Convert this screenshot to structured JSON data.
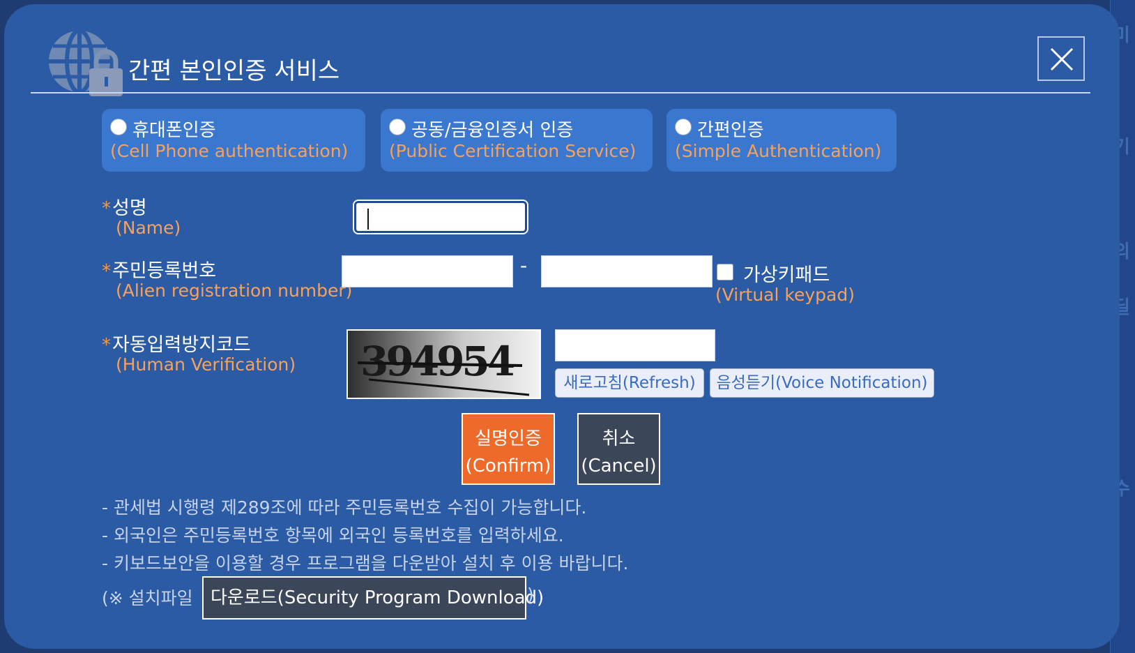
{
  "dialog": {
    "title": "간편 본인인증 서비스",
    "close_label": "X"
  },
  "auth_methods": [
    {
      "label_ko": "휴대폰인증",
      "label_en": "(Cell Phone authentication)",
      "selected": false
    },
    {
      "label_ko": "공동/금융인증서 인증",
      "label_en": "(Public Certification Service)",
      "selected": false
    },
    {
      "label_ko": "간편인증",
      "label_en": "(Simple Authentication)",
      "selected": false
    }
  ],
  "form": {
    "required_mark": "*",
    "name": {
      "label_ko": "성명",
      "label_en": "(Name)",
      "value": ""
    },
    "registration": {
      "label_ko": "주민등록번호",
      "label_en": "(Alien registration number)",
      "separator": "-",
      "part1": "",
      "part2": "",
      "virtual_keypad_ko": "가상키패드",
      "virtual_keypad_en": "(Virtual keypad)",
      "virtual_keypad_checked": false
    },
    "captcha": {
      "label_ko": "자동입력방지코드",
      "label_en": "(Human Verification)",
      "image_text": "394954",
      "value": "",
      "refresh_label": "새로고침(Refresh)",
      "voice_label": "음성듣기(Voice Notification)"
    }
  },
  "actions": {
    "confirm_ko": "실명인증",
    "confirm_en": "(Confirm)",
    "cancel_ko": "취소",
    "cancel_en": "(Cancel)"
  },
  "notices": [
    "- 관세법 시행령 제289조에 따라 주민등록번호 수집이 가능합니다.",
    "- 외국인은 주민등록번호 항목에 외국인 등록번호를 입력하세요.",
    "- 키보드보안을 이용할 경우 프로그램을 다운받아 설치 후 이용 바랍니다."
  ],
  "download": {
    "prefix": "(※ 설치파일",
    "button_label": "다운로드(Security Program Download)",
    "suffix": ")"
  },
  "colors": {
    "dialog_bg": "#2b5ba4",
    "tab_bg": "#3a77cf",
    "accent_orange": "#ee6a2a",
    "label_orange": "#f7a15a",
    "dark_button": "#3b4658"
  },
  "icons": {
    "header": "globe-lock-icon",
    "close": "close-icon"
  }
}
